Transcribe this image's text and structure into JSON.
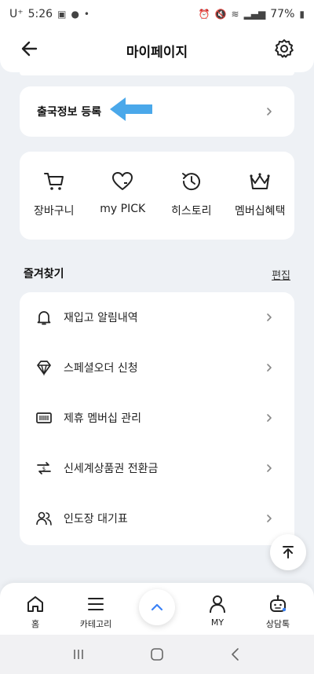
{
  "status_bar": {
    "carrier": "U⁺",
    "time": "5:26",
    "battery": "77%"
  },
  "header": {
    "title": "마이페이지"
  },
  "register": {
    "label": "출국정보 등록"
  },
  "quick_menu": [
    {
      "label": "장바구니",
      "icon": "cart-icon"
    },
    {
      "label": "my PICK",
      "icon": "heart-icon"
    },
    {
      "label": "히스토리",
      "icon": "history-icon"
    },
    {
      "label": "멤버십혜택",
      "icon": "crown-icon"
    }
  ],
  "favorites": {
    "title": "즐겨찾기",
    "edit_label": "편집",
    "items": [
      {
        "label": "재입고 알림내역",
        "icon": "bell-icon"
      },
      {
        "label": "스페셜오더 신청",
        "icon": "diamond-icon"
      },
      {
        "label": "제휴 멤버십 관리",
        "icon": "card-icon"
      },
      {
        "label": "신세계상품권 전환금",
        "icon": "exchange-icon"
      },
      {
        "label": "인도장 대기표",
        "icon": "people-icon"
      }
    ]
  },
  "bottom_nav": {
    "items": [
      {
        "label": "홈",
        "icon": "home-icon"
      },
      {
        "label": "카테고리",
        "icon": "menu-icon"
      },
      {
        "label": "MY",
        "icon": "person-icon"
      },
      {
        "label": "상담톡",
        "icon": "chatbot-icon"
      }
    ]
  },
  "colors": {
    "accent": "#3b82f6",
    "hint_arrow": "#4aa8ea",
    "background": "#eef1f5"
  }
}
